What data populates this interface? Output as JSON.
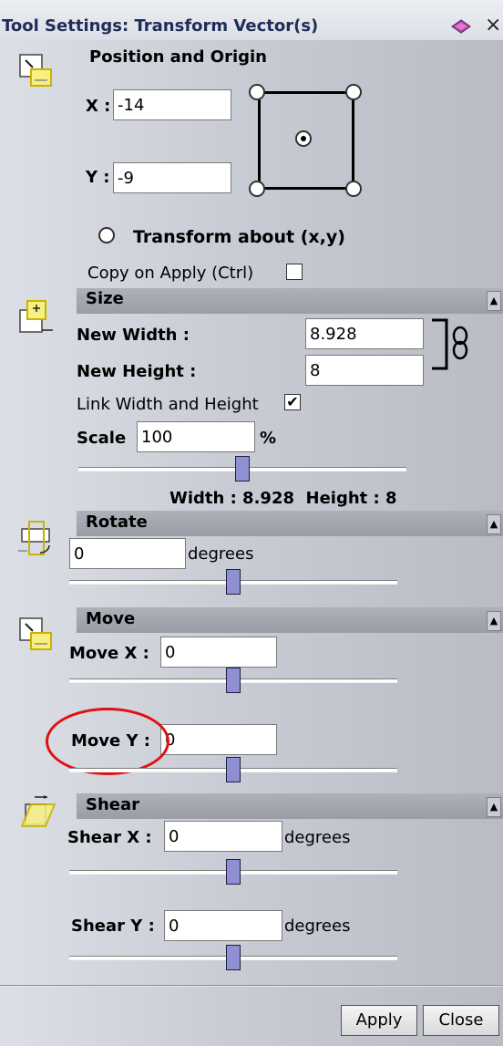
{
  "window": {
    "title": "Tool Settings: Transform Vector(s)",
    "close_glyph": "×",
    "icons": [
      "pin-icon",
      "close-icon"
    ]
  },
  "position": {
    "heading": "Position and Origin",
    "x_label": "X :",
    "x_value": "-14",
    "y_label": "Y :",
    "y_value": "-9",
    "transform_about_label": "Transform about (x,y)",
    "copy_on_apply_label": "Copy on Apply (Ctrl)",
    "copy_on_apply_checked": false
  },
  "size": {
    "heading": "Size",
    "collapse_glyph": "▲",
    "new_width_label": "New Width :",
    "new_width_value": "8.928",
    "new_height_label": "New Height :",
    "new_height_value": "8",
    "link_label": "Link Width and Height",
    "link_checked": true,
    "check_glyph": "✔",
    "scale_label": "Scale",
    "scale_value": "100",
    "scale_unit": "%",
    "summary": "Width : 8.928  Height : 8",
    "slider_level": 0.5
  },
  "rotate": {
    "heading": "Rotate",
    "collapse_glyph": "▲",
    "value": "0",
    "unit": "degrees",
    "slider_level": 0.5
  },
  "move": {
    "heading": "Move",
    "collapse_glyph": "▲",
    "x_label": "Move X :",
    "x_value": "0",
    "y_label": "Move Y :",
    "y_value": "0",
    "x_slider_level": 0.5,
    "y_slider_level": 0.5,
    "highlight_color": "#e01010"
  },
  "shear": {
    "heading": "Shear",
    "collapse_glyph": "▲",
    "x_label": "Shear X :",
    "x_value": "0",
    "x_unit": "degrees",
    "y_label": "Shear Y :",
    "y_value": "0",
    "y_unit": "degrees",
    "x_slider_level": 0.5,
    "y_slider_level": 0.5
  },
  "buttons": {
    "apply": "Apply",
    "close": "Close"
  },
  "colors": {
    "slider_thumb": "#8f8fd3",
    "title_text": "#1f2d58",
    "icon_yellow": "#f2e600"
  }
}
